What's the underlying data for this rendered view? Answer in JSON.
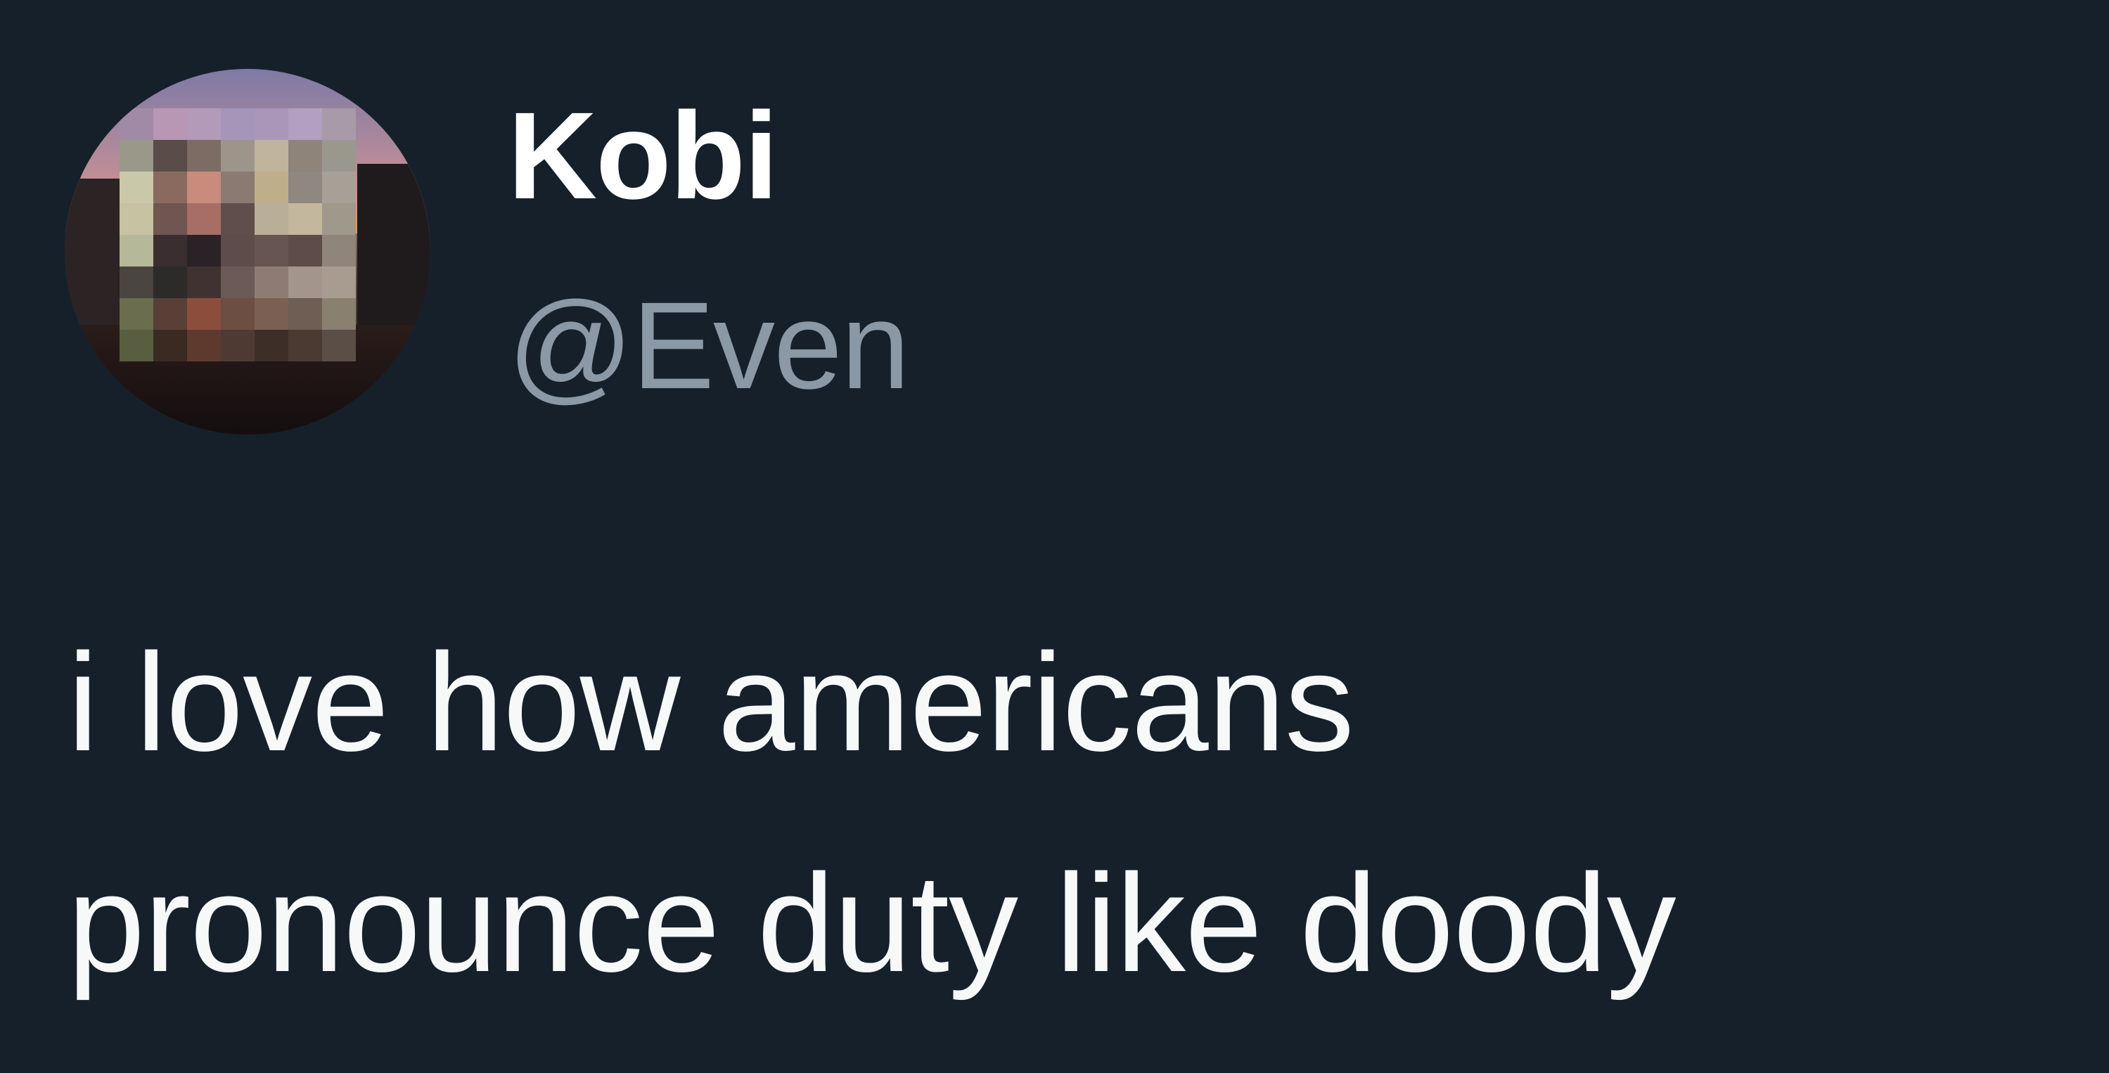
{
  "tweet": {
    "display_name": "Kobi",
    "handle": "@Even",
    "text_lines": [
      "i love how americans",
      "pronounce duty like doody"
    ]
  },
  "icons": {
    "avatar": "profile-avatar-pixelated"
  },
  "colors": {
    "background": "#15202b",
    "display_name": "#ffffff",
    "handle": "#8b98a5",
    "text": "#f7f9f9"
  }
}
